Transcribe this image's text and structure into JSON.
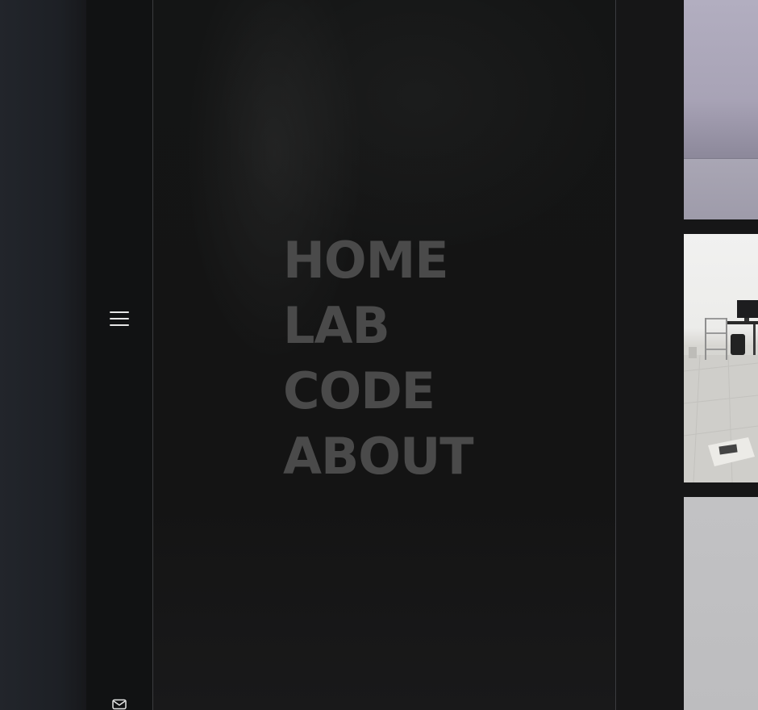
{
  "menu": {
    "items": [
      {
        "label": "HOME"
      },
      {
        "label": "LAB"
      },
      {
        "label": "CODE"
      },
      {
        "label": "ABOUT"
      }
    ],
    "text_color": "#4a4a4a"
  },
  "icons": {
    "menu_toggle": "hamburger-menu-icon",
    "contact": "mail-icon"
  },
  "colors": {
    "panel_background": "#141414",
    "icon_rail": "#111213",
    "icon_color": "#e6e6e6"
  },
  "gallery": {
    "images": [
      {
        "subject": "empty room with lavender walls"
      },
      {
        "subject": "lab room with desk, monitor and wire cart"
      },
      {
        "subject": "gray panel"
      }
    ]
  }
}
